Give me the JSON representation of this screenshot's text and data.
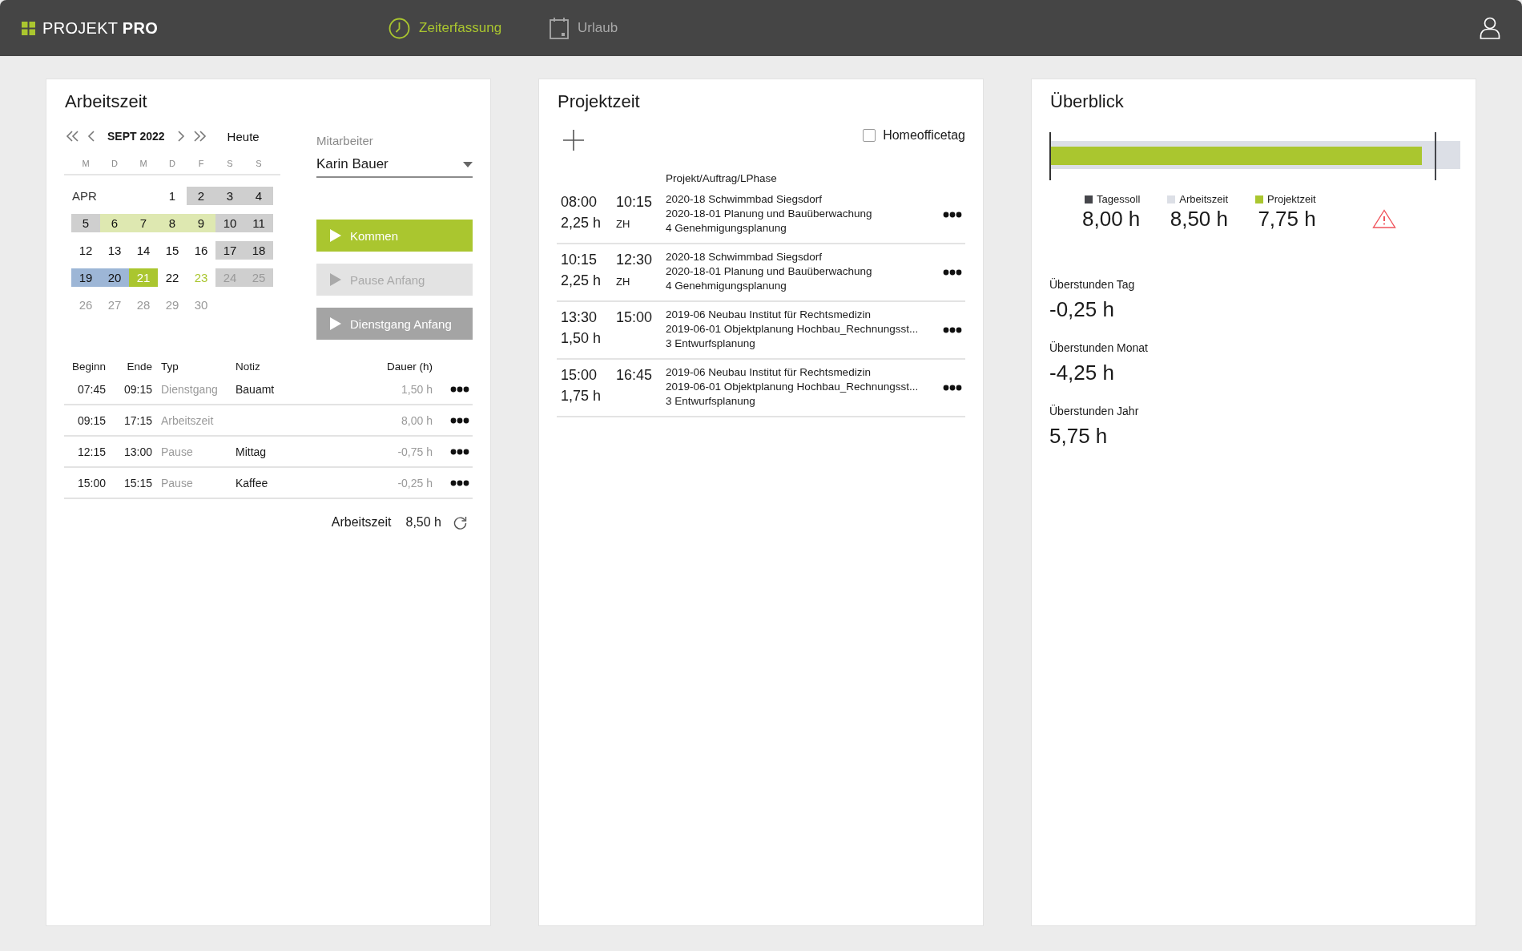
{
  "header": {
    "logo": "PROJEKT **PRO**",
    "tabs": [
      {
        "label": "Zeiterfassung",
        "kind": "clock",
        "selected": true
      },
      {
        "label": "Urlaub",
        "kind": "calendar",
        "selected": false
      }
    ]
  },
  "arbeitszeit": {
    "title": "Arbeitszeit",
    "calendar": {
      "month": "SEPT 2022",
      "today_link": "Heute",
      "weekdays": [
        "M",
        "D",
        "M",
        "D",
        "F",
        "S",
        "S"
      ],
      "weeks": [
        {
          "label": "APR",
          "days": [
            {
              "day": "1",
              "kind": "plain",
              "muted": false
            },
            {
              "day": "2",
              "kind": "closed",
              "muted": false
            },
            {
              "day": "3",
              "kind": "closed",
              "muted": false
            },
            {
              "day": "4",
              "kind": "closed",
              "muted": false
            }
          ]
        },
        {
          "days": [
            {
              "day": "5",
              "kind": "closed",
              "muted": false
            },
            {
              "day": "6",
              "kind": "leave",
              "muted": false
            },
            {
              "day": "7",
              "kind": "leave",
              "muted": false
            },
            {
              "day": "8",
              "kind": "leave",
              "muted": false
            },
            {
              "day": "9",
              "kind": "leave",
              "muted": false
            },
            {
              "day": "10",
              "kind": "closed",
              "muted": false
            },
            {
              "day": "11",
              "kind": "closed",
              "muted": false
            }
          ]
        },
        {
          "days": [
            {
              "day": "12",
              "kind": "plain",
              "muted": false
            },
            {
              "day": "13",
              "kind": "plain",
              "muted": false
            },
            {
              "day": "14",
              "kind": "plain",
              "muted": false
            },
            {
              "day": "15",
              "kind": "plain",
              "muted": false
            },
            {
              "day": "16",
              "kind": "plain",
              "muted": false
            },
            {
              "day": "17",
              "kind": "closed",
              "muted": false
            },
            {
              "day": "18",
              "kind": "closed",
              "muted": false
            }
          ]
        },
        {
          "days": [
            {
              "day": "19",
              "kind": "absent",
              "muted": false
            },
            {
              "day": "20",
              "kind": "absent",
              "muted": false
            },
            {
              "day": "21",
              "kind": "today",
              "muted": false
            },
            {
              "day": "22",
              "kind": "plain",
              "muted": false
            },
            {
              "day": "23",
              "kind": "highlight",
              "muted": false
            },
            {
              "day": "24",
              "kind": "closed",
              "muted": true
            },
            {
              "day": "25",
              "kind": "closed",
              "muted": true
            }
          ]
        },
        {
          "days": [
            {
              "day": "26",
              "kind": "plain",
              "muted": true
            },
            {
              "day": "27",
              "kind": "plain",
              "muted": true
            },
            {
              "day": "28",
              "kind": "plain",
              "muted": true
            },
            {
              "day": "29",
              "kind": "plain",
              "muted": true
            },
            {
              "day": "30",
              "kind": "plain",
              "muted": true
            }
          ]
        }
      ]
    },
    "employee": {
      "label": "Mitarbeiter",
      "value": "Karin Bauer"
    },
    "buttons": [
      {
        "label": "Kommen",
        "kind": "primary",
        "disabled": false
      },
      {
        "label": "Pause Anfang",
        "kind": "secondary",
        "disabled": true
      },
      {
        "label": "Dienstgang Anfang",
        "kind": "secondary",
        "disabled": false
      }
    ],
    "table": {
      "columns": [
        "Beginn",
        "Ende",
        "Typ",
        "Notiz",
        "Dauer (h)"
      ],
      "rows": [
        {
          "begin": "07:45",
          "end": "09:15",
          "type": "Dienstgang",
          "note": "Bauamt",
          "duration": "1,50 h"
        },
        {
          "begin": "09:15",
          "end": "17:15",
          "type": "Arbeitszeit",
          "duration": "8,00 h"
        },
        {
          "begin": "12:15",
          "end": "13:00",
          "type": "Pause",
          "note": "Mittag",
          "duration": "-0,75 h"
        },
        {
          "begin": "15:00",
          "end": "15:15",
          "type": "Pause",
          "note": "Kaffee",
          "duration": "-0,25 h"
        }
      ]
    },
    "total": {
      "label": "Arbeitszeit",
      "value": "8,50 h"
    }
  },
  "projektzeit": {
    "title": "Projektzeit",
    "homeoffice": {
      "label": "Homeofficetag",
      "checked": false
    },
    "column": "Projekt/Auftrag/LPhase",
    "rows": [
      {
        "start": "08:00",
        "end": "10:15",
        "duration": "2,25 h",
        "code": "ZH",
        "lines": [
          "2020-18 Schwimmbad Siegsdorf",
          "2020-18-01 Planung und Bauüberwachung",
          "4 Genehmigungsplanung"
        ]
      },
      {
        "start": "10:15",
        "end": "12:30",
        "duration": "2,25 h",
        "code": "ZH",
        "lines": [
          "2020-18 Schwimmbad Siegsdorf",
          "2020-18-01 Planung und Bauüberwachung",
          "4 Genehmigungsplanung"
        ]
      },
      {
        "start": "13:30",
        "end": "15:00",
        "duration": "1,50 h",
        "lines": [
          "2019-06 Neubau Institut für Rechtsmedizin",
          "2019-06-01 Objektplanung Hochbau_Rechnungsst...",
          "3 Entwurfsplanung"
        ]
      },
      {
        "start": "15:00",
        "end": "16:45",
        "duration": "1,75 h",
        "lines": [
          "2019-06 Neubau Institut für Rechtsmedizin",
          "2019-06-01 Objektplanung Hochbau_Rechnungsst...",
          "3 Entwurfsplanung"
        ]
      }
    ]
  },
  "ueberblick": {
    "title": "Überblick",
    "bar": {
      "level": 0.906,
      "target": {
        "level": 0.9375
      }
    },
    "legend": [
      {
        "label": "Tagessoll",
        "value": "8,00 h",
        "color": "#45464b"
      },
      {
        "label": "Arbeitszeit",
        "value": "8,50 h",
        "color": "#dcdfe6"
      },
      {
        "label": "Projektzeit",
        "value": "7,75 h",
        "color": "#aac62f"
      }
    ],
    "warning": true,
    "overtime": [
      {
        "label": "Überstunden Tag",
        "value": "-0,25 h"
      },
      {
        "label": "Überstunden Monat",
        "value": "-4,25 h"
      },
      {
        "label": "Überstunden Jahr",
        "value": "5,75 h"
      }
    ]
  }
}
